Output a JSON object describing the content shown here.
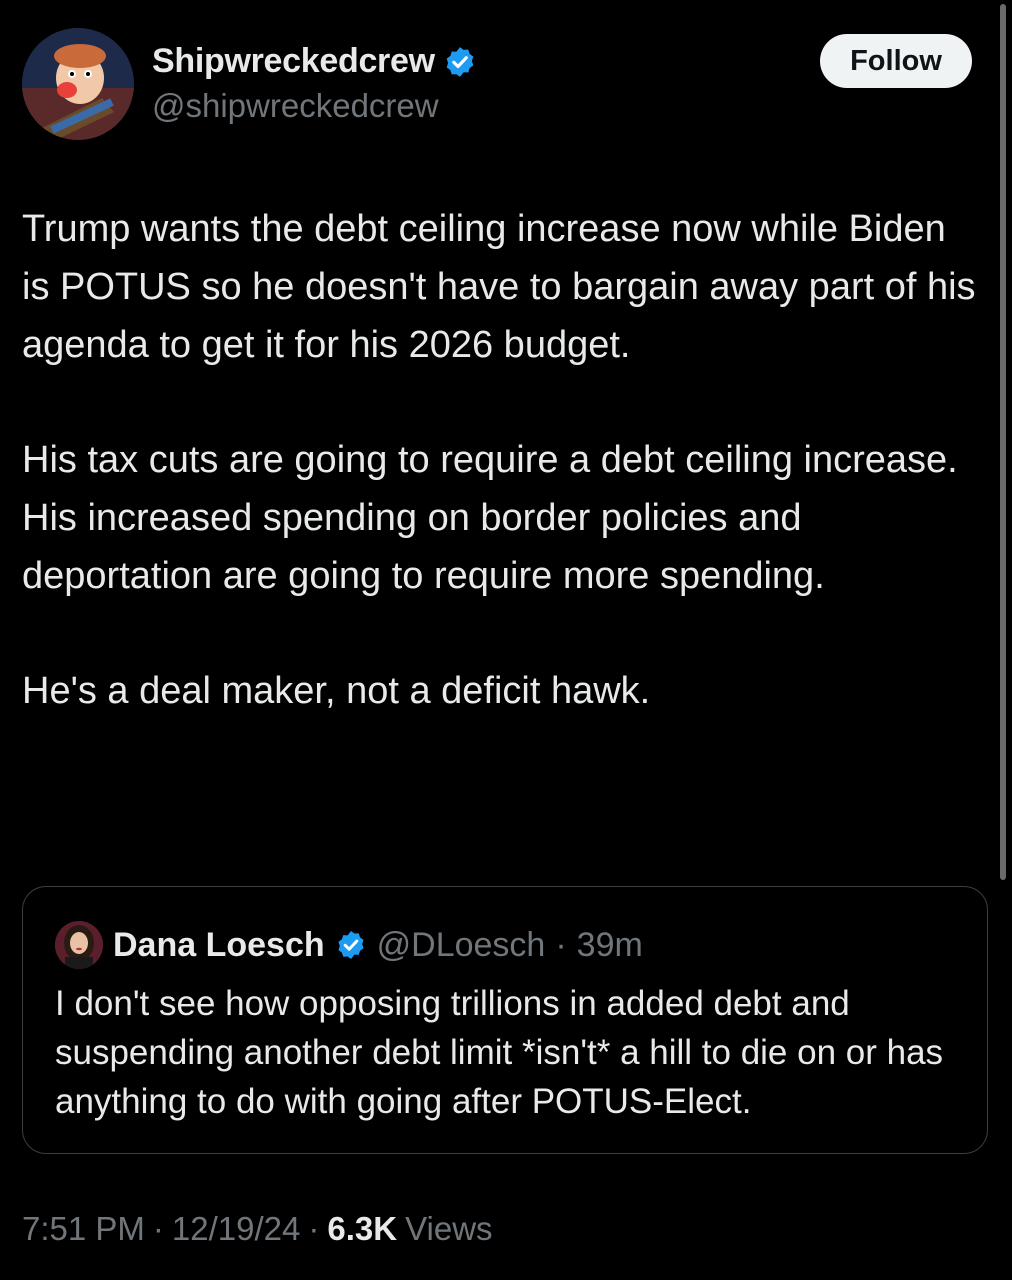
{
  "author": {
    "display_name": "Shipwreckedcrew",
    "handle": "@shipwreckedcrew",
    "verified": true,
    "avatar_icon": "cartoon-character-avatar"
  },
  "follow_label": "Follow",
  "tweet": {
    "paragraphs": [
      "Trump wants the debt ceiling increase now while Biden is POTUS so he doesn't have to bargain away part of his agenda to get it for his 2026 budget.",
      "His tax cuts are going to require a debt ceiling increase.  His increased spending on border policies and deportation are going to require more spending.",
      "He's a deal maker, not a deficit hawk."
    ]
  },
  "quote": {
    "display_name": "Dana Loesch",
    "handle": "@DLoesch",
    "separator": "·",
    "time": "39m",
    "verified": true,
    "text": "I don't see how opposing trillions in added debt and suspending another debt limit *isn't* a hill to die on or has anything to do with going after POTUS-Elect."
  },
  "meta": {
    "time": "7:51 PM",
    "sep1": "·",
    "date": "12/19/24",
    "sep2": "·",
    "views_count": "6.3K",
    "views_label": "Views"
  },
  "colors": {
    "background": "#000000",
    "text": "#e7e9ea",
    "secondary": "#71767b",
    "verified_blue": "#1d9bf0"
  }
}
